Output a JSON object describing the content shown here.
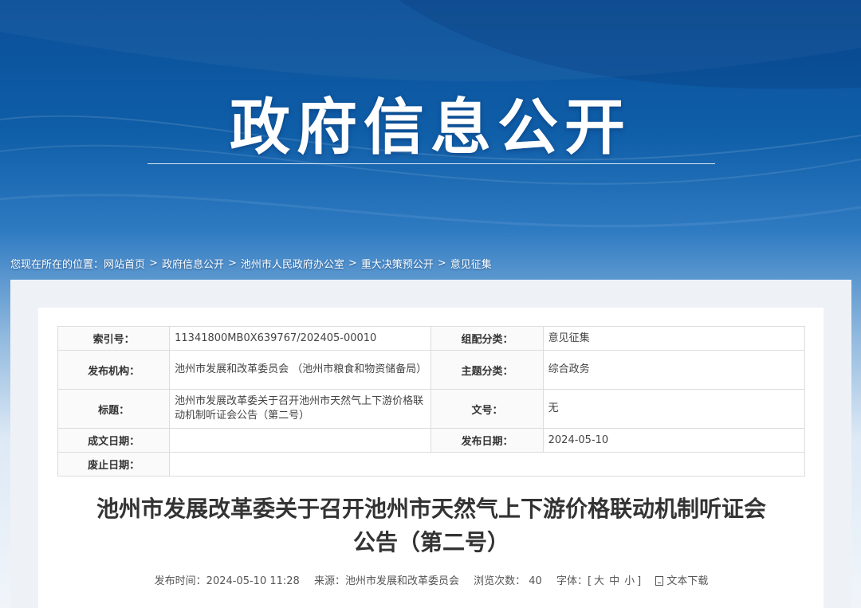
{
  "banner": {
    "title": "政府信息公开"
  },
  "breadcrumb": {
    "prefix": "您现在所在的位置：",
    "items": [
      "网站首页",
      "政府信息公开",
      "池州市人民政府办公室",
      "重大决策预公开",
      "意见征集"
    ],
    "separator": ">"
  },
  "meta": {
    "index_label": "索引号：",
    "index_value": "11341800MB0X639767/202405-00010",
    "category_label": "组配分类：",
    "category_value": "意见征集",
    "org_label": "发布机构：",
    "org_value": "池州市发展和改革委员会 （池州市粮食和物资储备局）",
    "topic_label": "主题分类：",
    "topic_value": "综合政务",
    "title_label": "标题：",
    "title_value": "池州市发展改革委关于召开池州市天然气上下游价格联动机制听证会公告（第二号）",
    "docno_label": "文号：",
    "docno_value": "无",
    "created_label": "成文日期：",
    "created_value": "",
    "published_label": "发布日期：",
    "published_value": "2024-05-10",
    "abolished_label": "废止日期：",
    "abolished_value": ""
  },
  "article": {
    "title_line1": "池州市发展改革委关于召开池州市天然气上下游价格联动机制听证会",
    "title_line2": "公告（第二号）",
    "publish_time": "发布时间：2024-05-10 11:28",
    "source": "来源：池州市发展和改革委员会",
    "views_label": "浏览次数：",
    "views": "40",
    "font_label": "字体：[",
    "font_large": "大",
    "font_medium": "中",
    "font_small": "小",
    "font_close": "]",
    "download": "文本下载"
  },
  "colors": {
    "banner_blue": "#0a4f98",
    "text": "#333333",
    "border": "#dcdcdc"
  }
}
